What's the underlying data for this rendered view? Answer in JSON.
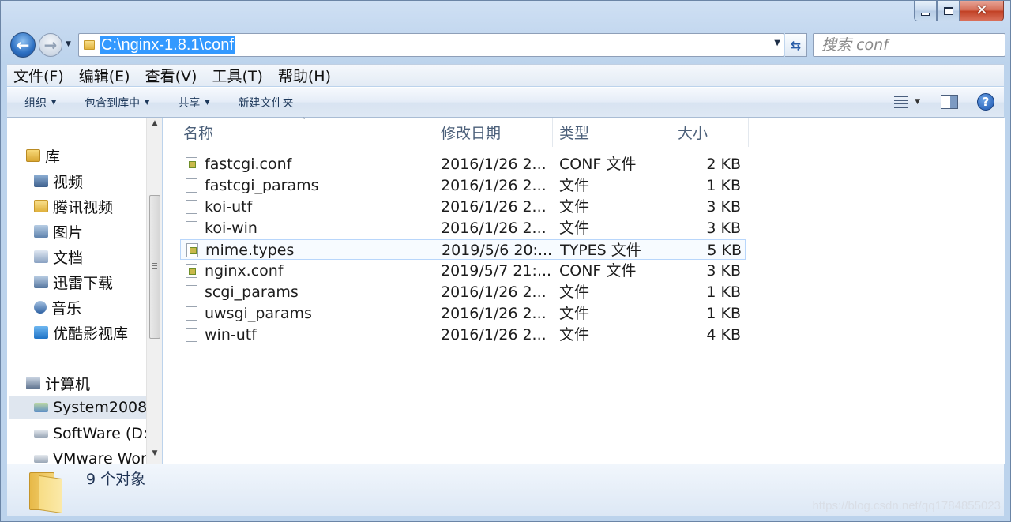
{
  "window": {
    "minimize_glyph": "",
    "close_glyph": "✕"
  },
  "nav": {
    "back_arrow": "←",
    "forward_arrow": "→",
    "refresh_glyph": "⇆"
  },
  "address": {
    "path": "C:\\nginx-1.8.1\\conf"
  },
  "search": {
    "placeholder": "搜索 conf"
  },
  "menu": [
    "文件(F)",
    "编辑(E)",
    "查看(V)",
    "工具(T)",
    "帮助(H)"
  ],
  "commands": {
    "organize": "组织",
    "include_library": "包含到库中",
    "share": "共享",
    "new_folder": "新建文件夹"
  },
  "help": {
    "glyph": "?"
  },
  "nav_pane": {
    "libraries": "库",
    "library_items": [
      "视频",
      "腾讯视频",
      "图片",
      "文档",
      "迅雷下载",
      "音乐",
      "优酷影视库"
    ],
    "computer": "计算机",
    "drives": [
      "System2008",
      "SoftWare (D:",
      "VMware Wor"
    ]
  },
  "columns": {
    "name": "名称",
    "modified": "修改日期",
    "type": "类型",
    "size": "大小"
  },
  "files": [
    {
      "name": "fastcgi.conf",
      "modified": "2016/1/26 2...",
      "type": "CONF 文件",
      "size": "2 KB",
      "icon": "config-file-icon"
    },
    {
      "name": "fastcgi_params",
      "modified": "2016/1/26 2...",
      "type": "文件",
      "size": "1 KB",
      "icon": "file-icon"
    },
    {
      "name": "koi-utf",
      "modified": "2016/1/26 2...",
      "type": "文件",
      "size": "3 KB",
      "icon": "file-icon"
    },
    {
      "name": "koi-win",
      "modified": "2016/1/26 2...",
      "type": "文件",
      "size": "3 KB",
      "icon": "file-icon"
    },
    {
      "name": "mime.types",
      "modified": "2019/5/6 20:...",
      "type": "TYPES 文件",
      "size": "5 KB",
      "icon": "config-file-icon"
    },
    {
      "name": "nginx.conf",
      "modified": "2019/5/7 21:...",
      "type": "CONF 文件",
      "size": "3 KB",
      "icon": "config-file-icon"
    },
    {
      "name": "scgi_params",
      "modified": "2016/1/26 2...",
      "type": "文件",
      "size": "1 KB",
      "icon": "file-icon"
    },
    {
      "name": "uwsgi_params",
      "modified": "2016/1/26 2...",
      "type": "文件",
      "size": "1 KB",
      "icon": "file-icon"
    },
    {
      "name": "win-utf",
      "modified": "2016/1/26 2...",
      "type": "文件",
      "size": "4 KB",
      "icon": "file-icon"
    }
  ],
  "status": {
    "count": "9 个对象"
  },
  "watermark": "https://blog.csdn.net/qq1784855023"
}
